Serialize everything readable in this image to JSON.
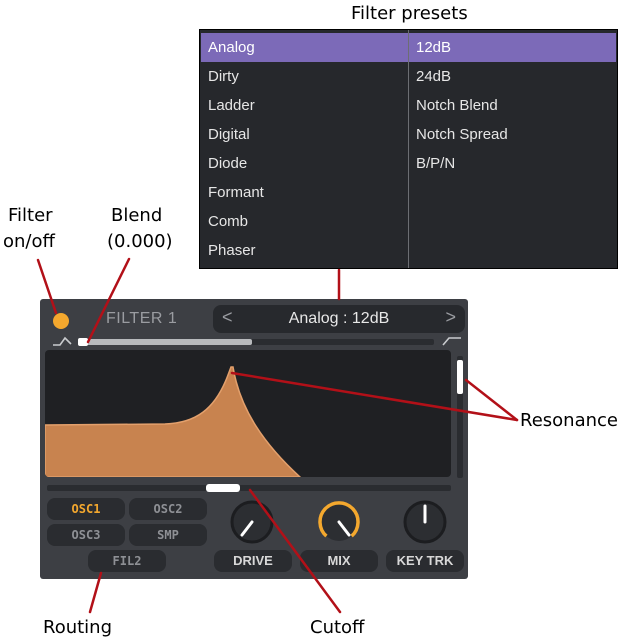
{
  "callouts": {
    "filter_presets": "Filter presets",
    "filter_onoff_line1": "Filter",
    "filter_onoff_line2": "on/off",
    "blend_line1": "Blend",
    "blend_line2": "(0.000)",
    "resonance": "Resonance",
    "routing": "Routing",
    "cutoff": "Cutoff"
  },
  "presets": {
    "types": [
      "Analog",
      "Dirty",
      "Ladder",
      "Digital",
      "Diode",
      "Formant",
      "Comb",
      "Phaser"
    ],
    "subtypes": [
      "12dB",
      "24dB",
      "Notch Blend",
      "Notch Spread",
      "B/P/N"
    ],
    "selected_type": "Analog",
    "selected_subtype": "12dB"
  },
  "filter": {
    "title": "FILTER 1",
    "prev_arrow": "<",
    "next_arrow": ">",
    "preset_name": "Analog : 12dB",
    "enabled": true,
    "blend": 0.0,
    "blend_fill_fraction": 0.49,
    "cutoff_fraction": 0.43,
    "resonance_fraction": 0.05,
    "accent_color": "#f4a82e",
    "curve_color": "#c8834f"
  },
  "routing": {
    "osc1": "OSC1",
    "osc2": "OSC2",
    "osc3": "OSC3",
    "smp": "SMP",
    "fil2": "FIL2"
  },
  "knobs": {
    "drive": "DRIVE",
    "mix": "MIX",
    "key_trk": "KEY TRK"
  }
}
